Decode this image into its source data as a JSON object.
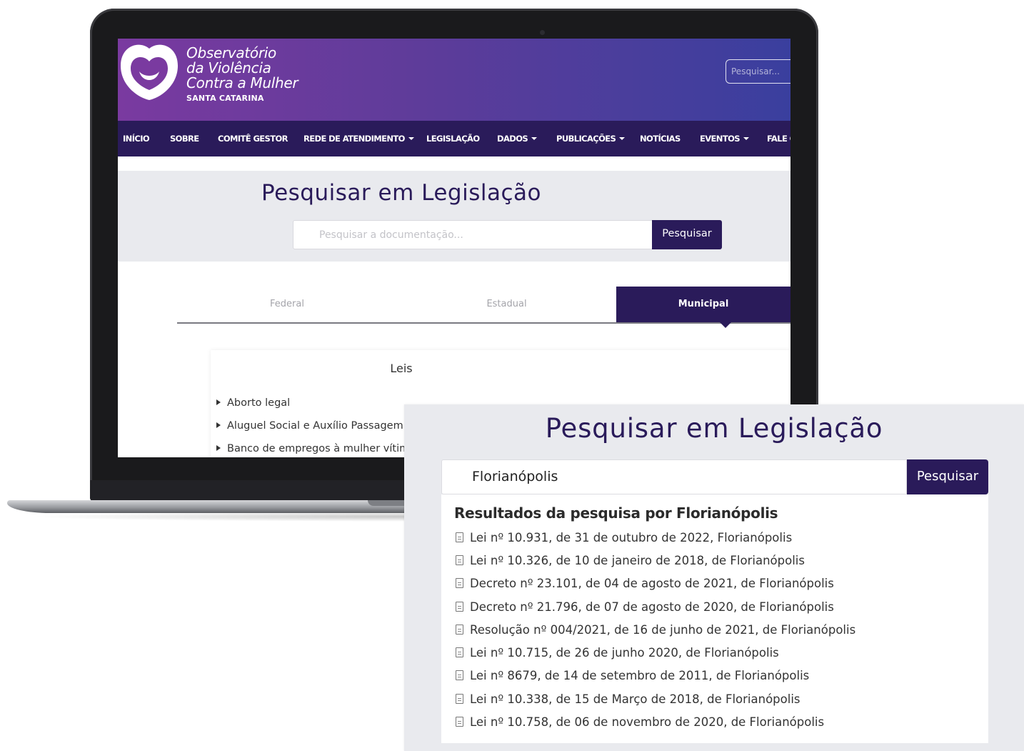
{
  "site": {
    "logo_lines": [
      "Observatório",
      "da Violência",
      "Contra a Mulher"
    ],
    "logo_sub": "SANTA CATARINA",
    "header_search_placeholder": "Pesquisar...",
    "brand_colors": {
      "header_start": "#7a3aa0",
      "header_end": "#3a3f9e",
      "nav": "#2a1b5a"
    }
  },
  "nav": {
    "items": [
      {
        "label": "INÍCIO",
        "dropdown": false
      },
      {
        "label": "SOBRE",
        "dropdown": false
      },
      {
        "label": "COMITÊ GESTOR",
        "dropdown": false
      },
      {
        "label": "REDE DE ATENDIMENTO",
        "dropdown": true
      },
      {
        "label": "LEGISLAÇÃO",
        "dropdown": false
      },
      {
        "label": "DADOS",
        "dropdown": true
      },
      {
        "label": "PUBLICAÇÕES",
        "dropdown": true
      },
      {
        "label": "NOTÍCIAS",
        "dropdown": false
      },
      {
        "label": "EVENTOS",
        "dropdown": true
      },
      {
        "label": "FALE C",
        "dropdown": false
      }
    ]
  },
  "search_page": {
    "title": "Pesquisar em Legislação",
    "input_placeholder": "Pesquisar a documentação...",
    "button_label": "Pesquisar"
  },
  "tabs": [
    {
      "label": "Federal",
      "active": false
    },
    {
      "label": "Estadual",
      "active": false
    },
    {
      "label": "Municipal",
      "active": true
    }
  ],
  "laws_panel": {
    "title": "Leis",
    "items": [
      "Aborto legal",
      "Aluguel Social e Auxílio Passagem",
      "Banco de empregos à mulher vítima"
    ]
  },
  "overlay": {
    "title": "Pesquisar em Legislação",
    "input_value": "Florianópolis",
    "button_label": "Pesquisar",
    "results_title": "Resultados da pesquisa por Florianópolis",
    "results": [
      "Lei nº 10.931, de 31 de outubro de 2022, Florianópolis",
      "Lei nº 10.326, de 10 de janeiro de 2018, de Florianópolis",
      "Decreto nº 23.101, de 04 de agosto de 2021, de Florianópolis",
      "Decreto nº 21.796, de 07 de agosto de 2020, de Florianópolis",
      "Resolução nº 004/2021, de 16 de junho de 2021, de Florianópolis",
      "Lei nº 10.715, de 26 de junho 2020, de Florianópolis",
      "Lei nº 8679, de 14 de setembro de 2011, de Florianópolis",
      "Lei nº 10.338, de 15 de Março de 2018, de Florianópolis",
      "Lei nº 10.758, de 06 de novembro de 2020, de Florianópolis"
    ]
  }
}
